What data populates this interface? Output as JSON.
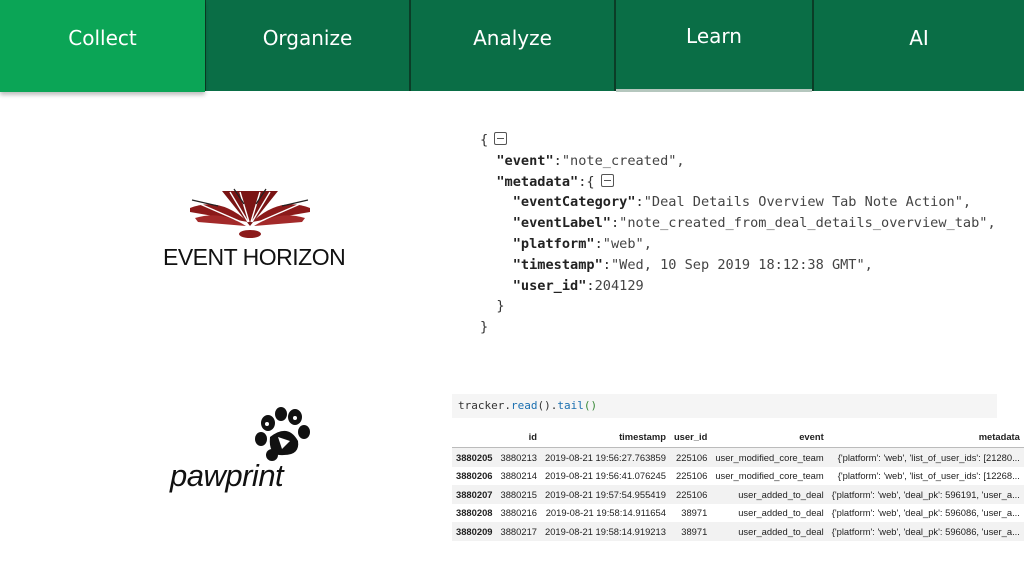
{
  "tabs": [
    {
      "label": "Collect",
      "active": true
    },
    {
      "label": "Organize",
      "active": false
    },
    {
      "label": "Analyze",
      "active": false
    },
    {
      "label": "Learn",
      "active": false
    },
    {
      "label": "AI",
      "active": false
    }
  ],
  "colors": {
    "tab_bg": "#0a6e46",
    "tab_active_bg": "#0ba556",
    "tab_separator": "#0b3d27",
    "eh_red": "#8b1a1a"
  },
  "logos": {
    "event_horizon": {
      "text": "EVENT HORIZON"
    },
    "pawprint": {
      "text": "pawprint"
    }
  },
  "json_example": {
    "open_brace": "{",
    "event_key": "\"event\"",
    "event_value": "\"note_created\",",
    "metadata_key": "\"metadata\"",
    "metadata_open": ":{",
    "category_key": "\"eventCategory\"",
    "category_value": "\"Deal Details Overview Tab Note Action\",",
    "label_key": "\"eventLabel\"",
    "label_value": "\"note_created_from_deal_details_overview_tab\",",
    "platform_key": "\"platform\"",
    "platform_value": "\"web\",",
    "timestamp_key": "\"timestamp\"",
    "timestamp_value": "\"Wed, 10 Sep 2019 18:12:38 GMT\",",
    "user_key": "\"user_id\"",
    "user_value": "204129",
    "close_inner": "}",
    "close_outer": "}"
  },
  "notebook": {
    "code": {
      "obj": "tracker.",
      "fn1": "read",
      "mid": "().",
      "fn2": "tail",
      "paren": "()"
    },
    "columns": [
      "",
      "id",
      "timestamp",
      "user_id",
      "event",
      "metadata"
    ],
    "rows": [
      {
        "index": "3880205",
        "id": "3880213",
        "timestamp": "2019-08-21 19:56:27.763859",
        "user_id": "225106",
        "event": "user_modified_core_team",
        "metadata": "{'platform': 'web', 'list_of_user_ids': [21280..."
      },
      {
        "index": "3880206",
        "id": "3880214",
        "timestamp": "2019-08-21 19:56:41.076245",
        "user_id": "225106",
        "event": "user_modified_core_team",
        "metadata": "{'platform': 'web', 'list_of_user_ids': [12268..."
      },
      {
        "index": "3880207",
        "id": "3880215",
        "timestamp": "2019-08-21 19:57:54.955419",
        "user_id": "225106",
        "event": "user_added_to_deal",
        "metadata": "{'platform': 'web', 'deal_pk': 596191, 'user_a..."
      },
      {
        "index": "3880208",
        "id": "3880216",
        "timestamp": "2019-08-21 19:58:14.911654",
        "user_id": "38971",
        "event": "user_added_to_deal",
        "metadata": "{'platform': 'web', 'deal_pk': 596086, 'user_a..."
      },
      {
        "index": "3880209",
        "id": "3880217",
        "timestamp": "2019-08-21 19:58:14.919213",
        "user_id": "38971",
        "event": "user_added_to_deal",
        "metadata": "{'platform': 'web', 'deal_pk': 596086, 'user_a..."
      }
    ]
  }
}
